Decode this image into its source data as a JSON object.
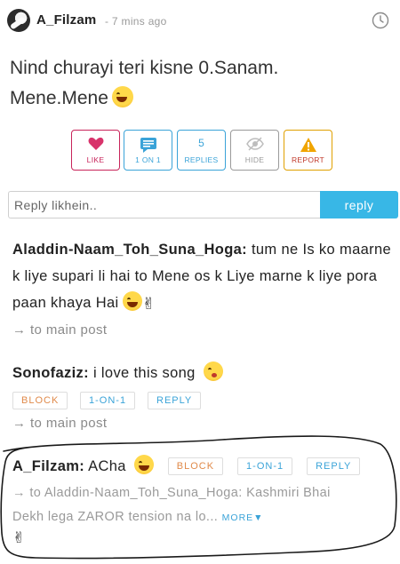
{
  "post": {
    "author": "A_Filzam",
    "time": "- 7 mins ago",
    "text_line1": "Nind churayi teri kisne 0.Sanam.",
    "text_line2": "Mene.Mene"
  },
  "actions": {
    "like_label": "LIKE",
    "one_on_one_label": "1 ON 1",
    "replies_count": "5",
    "replies_label": "REPLIES",
    "hide_label": "HIDE",
    "report_label": "REPORT"
  },
  "reply": {
    "placeholder": "Reply likhein..",
    "button_label": "reply"
  },
  "comments": [
    {
      "author": "Aladdin-Naam_Toh_Suna_Hoga",
      "separator": ":",
      "text": " tum ne Is ko maarne k liye supari li hai to Mene os k Liye marne k liye pora paan khaya Hai",
      "to_main": "→ to main post"
    },
    {
      "author": "Sonofaziz",
      "separator": ":",
      "text": " i love this song ",
      "block": "BLOCK",
      "one_on_one": "1-ON-1",
      "reply": "REPLY",
      "to_main": "→ to main post"
    },
    {
      "author": "A_Filzam",
      "separator": ":",
      "text": " ACha ",
      "block": "BLOCK",
      "one_on_one": "1-ON-1",
      "reply": "REPLY",
      "reply_to_line1": "→ to Aladdin-Naam_Toh_Suna_Hoga: Kashmiri Bhai",
      "reply_to_line2": "Dekh lega ZAROR tension na lo... ",
      "more": "MORE▼"
    }
  ],
  "colors": {
    "like": "#c8245a",
    "accent": "#38b7e6",
    "report": "#e0a000",
    "block": "#e08a4a"
  }
}
